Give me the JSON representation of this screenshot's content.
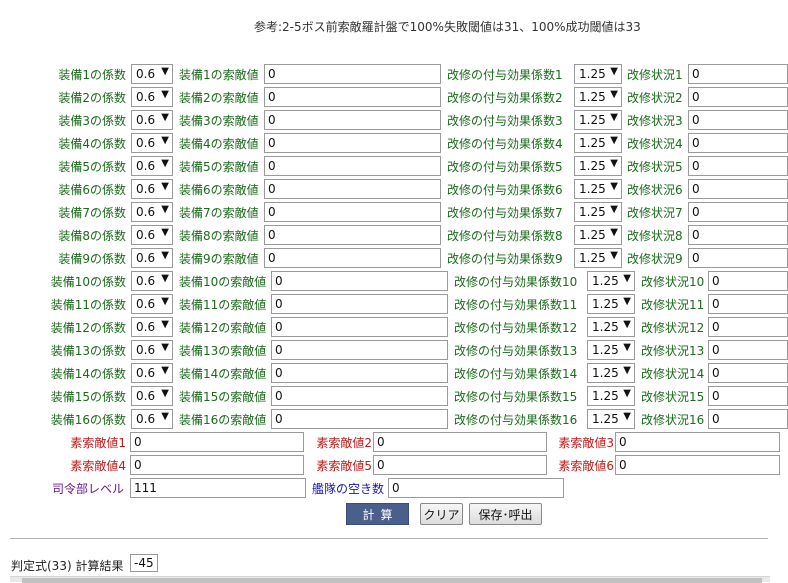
{
  "note": "参考:2-5ボス前索敵羅計盤で100%失敗閾値は31、100%成功閾値は33",
  "equipment": [
    {
      "coef_label": "装備1の係数",
      "coef": "0.6",
      "value_label": "装備1の索敵値",
      "value": "0",
      "upgrade_label": "改修の付与効果係数1",
      "upgrade_coef": "1.25",
      "status_label": "改修状況1",
      "status": "0"
    },
    {
      "coef_label": "装備2の係数",
      "coef": "0.6",
      "value_label": "装備2の索敵値",
      "value": "0",
      "upgrade_label": "改修の付与効果係数2",
      "upgrade_coef": "1.25",
      "status_label": "改修状況2",
      "status": "0"
    },
    {
      "coef_label": "装備3の係数",
      "coef": "0.6",
      "value_label": "装備3の索敵値",
      "value": "0",
      "upgrade_label": "改修の付与効果係数3",
      "upgrade_coef": "1.25",
      "status_label": "改修状況3",
      "status": "0"
    },
    {
      "coef_label": "装備4の係数",
      "coef": "0.6",
      "value_label": "装備4の索敵値",
      "value": "0",
      "upgrade_label": "改修の付与効果係数4",
      "upgrade_coef": "1.25",
      "status_label": "改修状況4",
      "status": "0"
    },
    {
      "coef_label": "装備5の係数",
      "coef": "0.6",
      "value_label": "装備5の索敵値",
      "value": "0",
      "upgrade_label": "改修の付与効果係数5",
      "upgrade_coef": "1.25",
      "status_label": "改修状況5",
      "status": "0"
    },
    {
      "coef_label": "装備6の係数",
      "coef": "0.6",
      "value_label": "装備6の索敵値",
      "value": "0",
      "upgrade_label": "改修の付与効果係数6",
      "upgrade_coef": "1.25",
      "status_label": "改修状況6",
      "status": "0"
    },
    {
      "coef_label": "装備7の係数",
      "coef": "0.6",
      "value_label": "装備7の索敵値",
      "value": "0",
      "upgrade_label": "改修の付与効果係数7",
      "upgrade_coef": "1.25",
      "status_label": "改修状況7",
      "status": "0"
    },
    {
      "coef_label": "装備8の係数",
      "coef": "0.6",
      "value_label": "装備8の索敵値",
      "value": "0",
      "upgrade_label": "改修の付与効果係数8",
      "upgrade_coef": "1.25",
      "status_label": "改修状況8",
      "status": "0"
    },
    {
      "coef_label": "装備9の係数",
      "coef": "0.6",
      "value_label": "装備9の索敵値",
      "value": "0",
      "upgrade_label": "改修の付与効果係数9",
      "upgrade_coef": "1.25",
      "status_label": "改修状況9",
      "status": "0"
    },
    {
      "coef_label": "装備10の係数",
      "coef": "0.6",
      "value_label": "装備10の索敵値",
      "value": "0",
      "upgrade_label": "改修の付与効果係数10",
      "upgrade_coef": "1.25",
      "status_label": "改修状況10",
      "status": "0"
    },
    {
      "coef_label": "装備11の係数",
      "coef": "0.6",
      "value_label": "装備11の索敵値",
      "value": "0",
      "upgrade_label": "改修の付与効果係数11",
      "upgrade_coef": "1.25",
      "status_label": "改修状況11",
      "status": "0"
    },
    {
      "coef_label": "装備12の係数",
      "coef": "0.6",
      "value_label": "装備12の索敵値",
      "value": "0",
      "upgrade_label": "改修の付与効果係数12",
      "upgrade_coef": "1.25",
      "status_label": "改修状況12",
      "status": "0"
    },
    {
      "coef_label": "装備13の係数",
      "coef": "0.6",
      "value_label": "装備13の索敵値",
      "value": "0",
      "upgrade_label": "改修の付与効果係数13",
      "upgrade_coef": "1.25",
      "status_label": "改修状況13",
      "status": "0"
    },
    {
      "coef_label": "装備14の係数",
      "coef": "0.6",
      "value_label": "装備14の索敵値",
      "value": "0",
      "upgrade_label": "改修の付与効果係数14",
      "upgrade_coef": "1.25",
      "status_label": "改修状況14",
      "status": "0"
    },
    {
      "coef_label": "装備15の係数",
      "coef": "0.6",
      "value_label": "装備15の索敵値",
      "value": "0",
      "upgrade_label": "改修の付与効果係数15",
      "upgrade_coef": "1.25",
      "status_label": "改修状況15",
      "status": "0"
    },
    {
      "coef_label": "装備16の係数",
      "coef": "0.6",
      "value_label": "装備16の索敵値",
      "value": "0",
      "upgrade_label": "改修の付与効果係数16",
      "upgrade_coef": "1.25",
      "status_label": "改修状況16",
      "status": "0"
    }
  ],
  "elements": [
    {
      "label": "素索敵値1",
      "value": "0"
    },
    {
      "label": "素索敵値2",
      "value": "0"
    },
    {
      "label": "素索敵値3",
      "value": "0"
    },
    {
      "label": "素索敵値4",
      "value": "0"
    },
    {
      "label": "素索敵値5",
      "value": "0"
    },
    {
      "label": "素索敵値6",
      "value": "0"
    }
  ],
  "hq_level_label": "司令部レベル",
  "hq_level": "111",
  "fleet_empty_label": "艦隊の空き数",
  "fleet_empty": "0",
  "buttons": {
    "calc": "計算",
    "clear": "クリア",
    "save": "保存･呼出"
  },
  "result_label": "判定式(33) 計算結果",
  "result_value": "-45"
}
